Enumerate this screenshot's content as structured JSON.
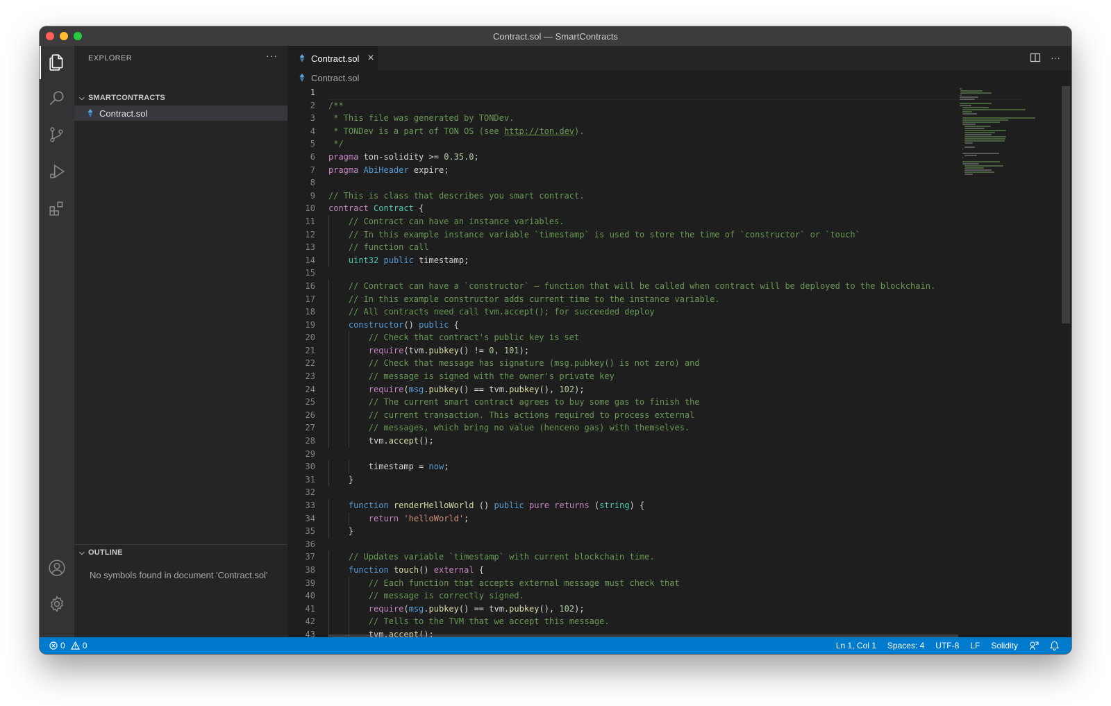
{
  "window": {
    "title": "Contract.sol — SmartContracts"
  },
  "sidebar": {
    "title": "EXPLORER",
    "more": "···",
    "folder": "SMARTCONTRACTS",
    "file": "Contract.sol",
    "outline": {
      "title": "OUTLINE",
      "message": "No symbols found in document 'Contract.sol'"
    }
  },
  "editor": {
    "tab_label": "Contract.sol",
    "tab_close": "×",
    "breadcrumb": "Contract.sol",
    "more": "···",
    "line_numbers": [
      "1",
      "2",
      "3",
      "4",
      "5",
      "6",
      "7",
      "8",
      "9",
      "10",
      "11",
      "12",
      "13",
      "14",
      "15",
      "16",
      "17",
      "18",
      "19",
      "20",
      "21",
      "22",
      "23",
      "24",
      "25",
      "26",
      "27",
      "28",
      "29",
      "30",
      "31",
      "32",
      "33",
      "34",
      "35",
      "36",
      "37",
      "38",
      "39",
      "40",
      "41",
      "42",
      "43"
    ],
    "lines": [
      "",
      "/**",
      " * This file was generated by TONDev.",
      " * TONDev is a part of TON OS (see http://ton.dev).",
      " */",
      "pragma ton-solidity >= 0.35.0;",
      "pragma AbiHeader expire;",
      "",
      "// This is class that describes you smart contract.",
      "contract Contract {",
      "    // Contract can have an instance variables.",
      "    // In this example instance variable `timestamp` is used to store the time of `constructor` or `touch`",
      "    // function call",
      "    uint32 public timestamp;",
      "",
      "    // Contract can have a `constructor` – function that will be called when contract will be deployed to the blockchain.",
      "    // In this example constructor adds current time to the instance variable.",
      "    // All contracts need call tvm.accept(); for succeeded deploy",
      "    constructor() public {",
      "        // Check that contract's public key is set",
      "        require(tvm.pubkey() != 0, 101);",
      "        // Check that message has signature (msg.pubkey() is not zero) and",
      "        // message is signed with the owner's private key",
      "        require(msg.pubkey() == tvm.pubkey(), 102);",
      "        // The current smart contract agrees to buy some gas to finish the",
      "        // current transaction. This actions required to process external",
      "        // messages, which bring no value (henceno gas) with themselves.",
      "        tvm.accept();",
      "",
      "        timestamp = now;",
      "    }",
      "",
      "    function renderHelloWorld () public pure returns (string) {",
      "        return 'helloWorld';",
      "    }",
      "",
      "    // Updates variable `timestamp` with current blockchain time.",
      "    function touch() external {",
      "        // Each function that accepts external message must check that",
      "        // message is correctly signed.",
      "        require(msg.pubkey() == tvm.pubkey(), 102);",
      "        // Tells to the TVM that we accept this message.",
      "        tvm.accept();"
    ]
  },
  "status": {
    "errors": "0",
    "warnings": "0",
    "position": "Ln 1, Col 1",
    "spaces": "Spaces: 4",
    "encoding": "UTF-8",
    "eol": "LF",
    "language": "Solidity"
  },
  "colors": {
    "accent": "#007acc",
    "comment": "#6a9955",
    "keyword": "#c586c0",
    "builtin": "#569cd6",
    "type": "#4ec9b0",
    "function": "#dcdcaa",
    "string": "#ce9178",
    "number": "#b5cea8"
  }
}
